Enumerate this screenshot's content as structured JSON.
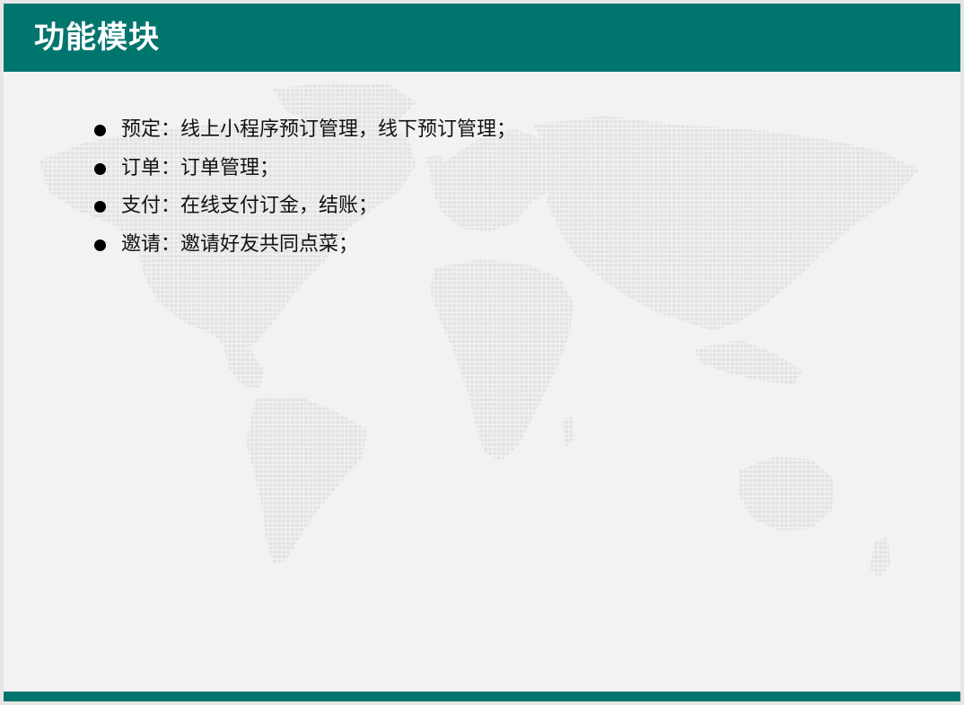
{
  "slide": {
    "title": "功能模块",
    "items": [
      "预定：线上小程序预订管理，线下预订管理；",
      "订单：订单管理；",
      "支付：在线支付订金，结账；",
      "邀请：邀请好友共同点菜；"
    ]
  },
  "background_icon": "world-map-dotted-icon",
  "colors": {
    "accent": "#00756e",
    "background": "#f2f2f2",
    "text": "#111111",
    "map_dots": "#e5e5e5"
  }
}
